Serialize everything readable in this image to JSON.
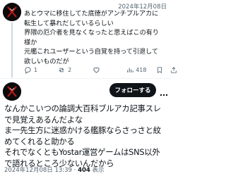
{
  "reply": {
    "date": "2024年12月08日",
    "text": "あとウマに移住してた底徳がアンチプルアカに\n転生して暴れだしているらしい\n界隈の厄介者を見なくなったと思えばこの有り\n様か\n元艦これユーザーという自覚を持って引退して\n欲しいものだが",
    "actions": {
      "reply_count": "1",
      "retweet_count": "2",
      "like_count": "",
      "views_count": "418"
    }
  },
  "main": {
    "follow_label": "フォローする",
    "text": "なんかこいつの論調大百科ブルアカ記事スレ\nで見覚えあるんだよな\nま一先生方に迷惑かける艦豚ならさっさと紋\nめてくれると助かる\nそれでなくともYostar運営ゲームはSNS以外\nで語れるところ少ないんだから",
    "timestamp": "2024年12月08日 13:39 ·",
    "views": "404",
    "views_label": "表示"
  },
  "icons": [
    "avatar",
    "reply-icon",
    "retweet-icon",
    "like-icon",
    "views-icon",
    "bookmark-icon",
    "share-icon",
    "more-icon"
  ]
}
